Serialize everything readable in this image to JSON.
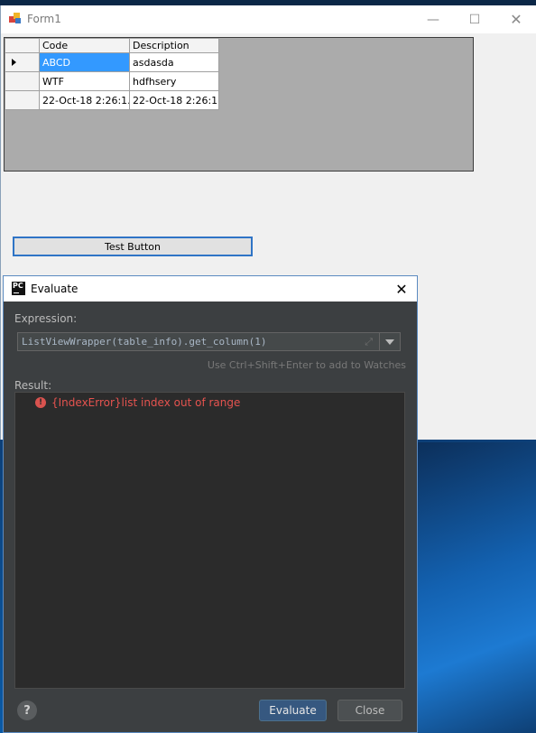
{
  "form": {
    "title": "Form1",
    "controls": {
      "minimize": "—",
      "maximize": "☐",
      "close": "✕"
    },
    "grid": {
      "headers": [
        "Code",
        "Description"
      ],
      "rows": [
        [
          "ABCD",
          "asdasda"
        ],
        [
          "WTF",
          "hdfhsery"
        ],
        [
          "22-Oct-18 2:26:1...",
          "22-Oct-18 2:26:1..."
        ]
      ],
      "selected_row": 0
    },
    "test_button": "Test Button"
  },
  "dialog": {
    "title": "Evaluate",
    "close_glyph": "✕",
    "expression_label": "Expression:",
    "expression": "ListViewWrapper(table_info).get_column(1)",
    "watch_hint": "Use Ctrl+Shift+Enter to add to Watches",
    "result_label": "Result:",
    "result_error": "{IndexError}list index out of range",
    "help_label": "?",
    "evaluate_button": "Evaluate",
    "close_button": "Close"
  },
  "colors": {
    "selection": "#3399ff",
    "error": "#e5534f",
    "dialog_bg": "#3c3f41",
    "primary_button": "#365880"
  }
}
